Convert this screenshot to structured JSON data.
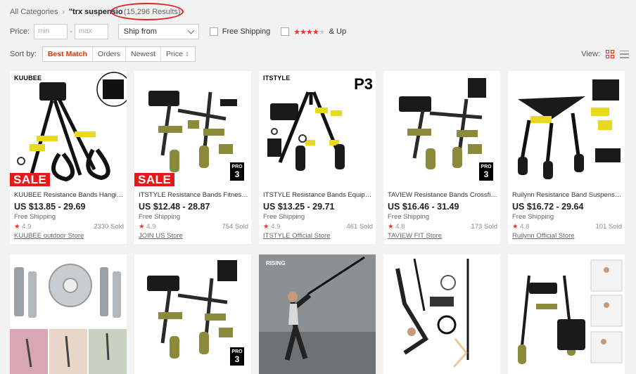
{
  "breadcrumb": {
    "root": "All Categories",
    "query": "\"trx suspensio",
    "count": "(15,296 Results)"
  },
  "filters": {
    "price_label": "Price:",
    "min_placeholder": "min",
    "max_placeholder": "max",
    "ship_from": "Ship from",
    "free_shipping": "Free Shipping",
    "and_up": "& Up"
  },
  "sort": {
    "label": "Sort by:",
    "options": [
      "Best Match",
      "Orders",
      "Newest",
      "Price"
    ],
    "view_label": "View:"
  },
  "products": [
    {
      "title": "KUUBEE Resistance Bands Hanging Belt",
      "price": "US $13.85 - 29.69",
      "shipping": "Free Shipping",
      "rating": "4.9",
      "sold": "2330 Sold",
      "store": "KUUBEE outdoor Store",
      "badge": "SALE",
      "brand": "KUUBEE"
    },
    {
      "title": "ITSTYLE Resistance Bands Fitness Exercise",
      "price": "US $12.48 - 28.87",
      "shipping": "Free Shipping",
      "rating": "4.9",
      "sold": "754 Sold",
      "store": "JOIN US Store",
      "badge": "SALE",
      "brand": ""
    },
    {
      "title": "ITSTYLE Resistance Bands Equipment",
      "price": "US $13.25 - 29.71",
      "shipping": "Free Shipping",
      "rating": "4.9",
      "sold": "461 Sold",
      "store": "ITSTYLE Official Store",
      "badge": "",
      "brand": "ITSTYLE"
    },
    {
      "title": "TAVIEW Resistance Bands Crossfit Training",
      "price": "US $16.46 - 31.49",
      "shipping": "Free Shipping",
      "rating": "4.8",
      "sold": "173 Sold",
      "store": "TAVIEW FIT Store",
      "badge": "",
      "brand": ""
    },
    {
      "title": "Ruilynn Resistance Band Suspension Trainer",
      "price": "US $16.72 - 29.64",
      "shipping": "Free Shipping",
      "rating": "4.8",
      "sold": "101 Sold",
      "store": "Ruilynn Official Store",
      "badge": "",
      "brand": ""
    }
  ],
  "image_text": {
    "p3": "P3",
    "pro": "PRO",
    "pro_num": "3",
    "rising": "RISING"
  },
  "colors": {
    "accent": "#e62e04",
    "sale": "#e61919",
    "highlight": "#e02424",
    "strap_yellow": "#e8d81e",
    "strap_olive": "#8a8a3a"
  }
}
